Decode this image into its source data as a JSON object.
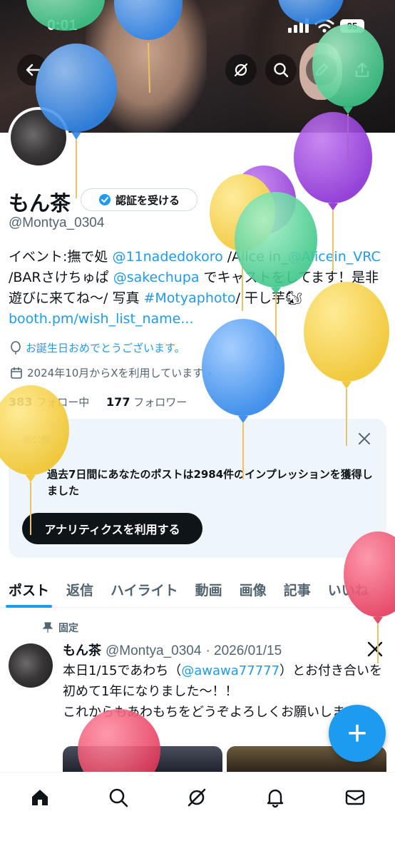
{
  "status_bar": {
    "time": "0:01",
    "battery": "95"
  },
  "profile": {
    "name": "もん茶",
    "verify_label": "認証を受ける",
    "handle": "@Montya_0304",
    "bio": {
      "p1": "イベント:撫で処 ",
      "l1": "@11nadedokoro",
      "p2": " /Alice in_",
      "l2": "@Alicein_VRC",
      "p3": " /BARさけちゅぱ ",
      "l3": "@sakechupa",
      "p4": " でキャストをしてます！是非遊びに来てね〜/ 写真 ",
      "l4": "#Motyaphoto",
      "p5": "/ 干し芋🐿 ",
      "l5": "booth.pm/wish_list_name..."
    },
    "birthday": "お誕生日おめでとうございます。",
    "joined": "2024年10月からXを利用しています",
    "following_count": "383",
    "following_label": "フォロー中",
    "followers_count": "177",
    "followers_label": "フォロワー"
  },
  "card": {
    "private_label": "非公開",
    "title": "過去7日間にあなたのポストは2984件のインプレッションを獲得しました",
    "button": "アナリティクスを利用する"
  },
  "tabs": [
    "ポスト",
    "返信",
    "ハイライト",
    "動画",
    "画像",
    "記事",
    "いいね"
  ],
  "pinned_post": {
    "pinned_label": "固定",
    "author": "もん茶",
    "handle": "@Montya_0304",
    "date": "· 2026/01/15",
    "t1": "本日1/15であわち（",
    "mention": "@awawa77777",
    "t2": "）とお付き合いを初めて1年になりました〜！！",
    "t3": "これからもあわもちをどうぞよろしくお願いします🫶"
  },
  "fab_label": "+",
  "colors": {
    "accent": "#1d9bf0",
    "text": "#0f1419",
    "secondary": "#536471"
  }
}
